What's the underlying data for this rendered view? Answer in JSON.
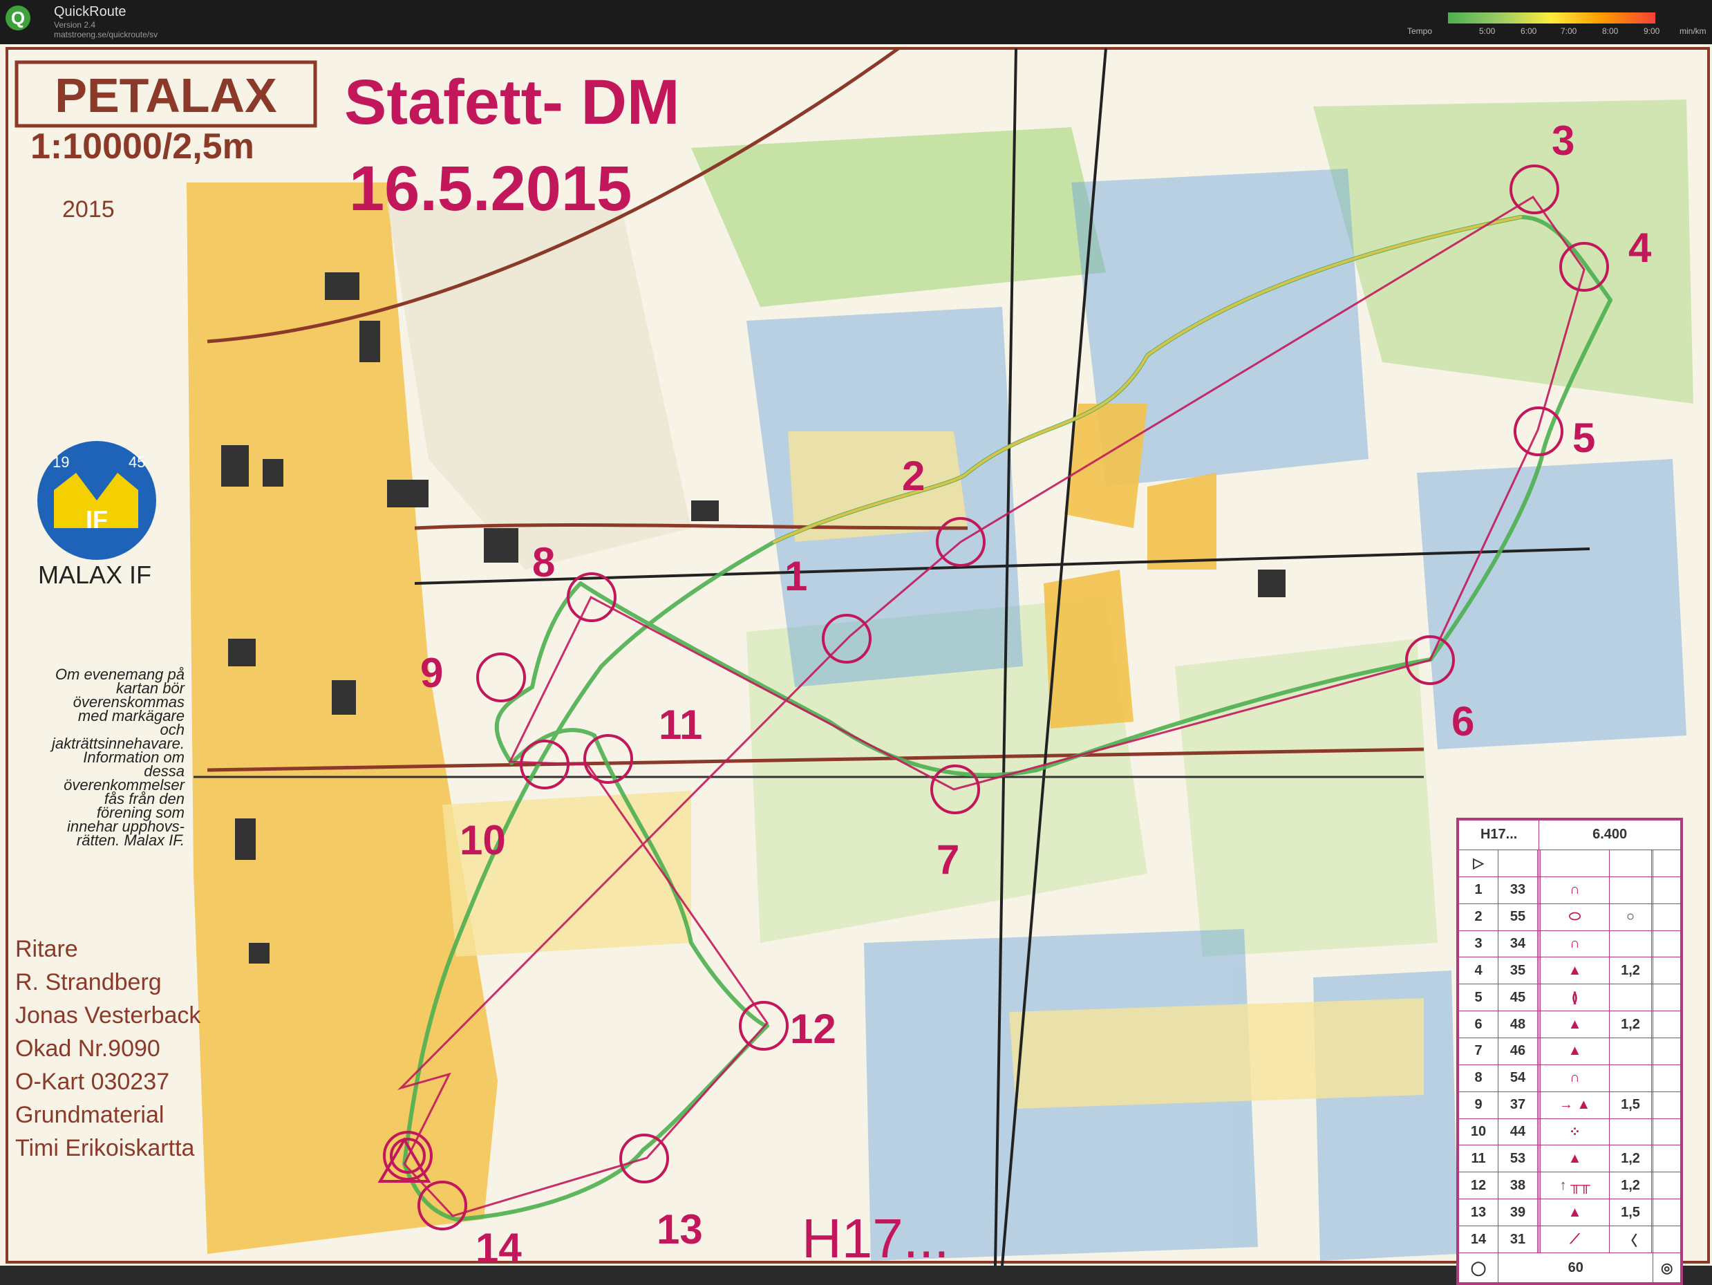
{
  "app": {
    "name": "QuickRoute",
    "version": "Version 2.4",
    "url": "matstroeng.se/quickroute/sv",
    "tempo_label": "Tempo",
    "tempo_ticks": [
      "5:00",
      "6:00",
      "7:00",
      "8:00",
      "9:00",
      "min/km"
    ]
  },
  "map": {
    "club_name": "PETALAX",
    "scale": "1:10000/2,5m",
    "year": "2015",
    "event_title": "Stafett- DM",
    "event_date": "16.5.2015",
    "class_label": "H17...",
    "club_logo_text": {
      "years_left": "19",
      "years_right": "45",
      "letters": "IF"
    },
    "club_caption": "MALAX  IF",
    "notice_lines": [
      "Om evenemang på",
      "kartan bör",
      "överenskommas",
      "med markägare",
      "och",
      "jakträttsinnehavare.",
      "Information om",
      "dessa",
      "överenkommelser",
      "fås från den",
      "förening som",
      "innehar upphovs-",
      "rätten. Malax IF."
    ],
    "credits": [
      "Ritare",
      "R. Strandberg",
      "Jonas Vesterback",
      "Okad Nr.9090",
      "O-Kart 030237",
      "Grundmaterial",
      "Timi Erikoiskartta"
    ],
    "controls": [
      {
        "n": "1"
      },
      {
        "n": "2"
      },
      {
        "n": "3"
      },
      {
        "n": "4"
      },
      {
        "n": "5"
      },
      {
        "n": "6"
      },
      {
        "n": "7"
      },
      {
        "n": "8"
      },
      {
        "n": "9"
      },
      {
        "n": "10"
      },
      {
        "n": "11"
      },
      {
        "n": "12"
      },
      {
        "n": "13"
      },
      {
        "n": "14"
      }
    ],
    "colors": {
      "course": "#c2185b",
      "route_green": "#4caf50",
      "route_yellow": "#e8c34a",
      "map_bg": "#ffffff",
      "forest_green": "#b7dc8f",
      "open_yellow": "#f2c24b",
      "marsh_blue": "#5a9bd4",
      "road_brown": "#8b3a2a"
    }
  },
  "description_sheet": {
    "class": "H17...",
    "length": "6.400",
    "rows": [
      {
        "n": "1",
        "code": "33",
        "feature": "∩",
        "extra": ""
      },
      {
        "n": "2",
        "code": "55",
        "feature": "⬭",
        "extra": "○"
      },
      {
        "n": "3",
        "code": "34",
        "feature": "∩",
        "extra": ""
      },
      {
        "n": "4",
        "code": "35",
        "feature": "▲",
        "extra": "1,2"
      },
      {
        "n": "5",
        "code": "45",
        "feature": "≬",
        "extra": ""
      },
      {
        "n": "6",
        "code": "48",
        "feature": "▲",
        "extra": "1,2"
      },
      {
        "n": "7",
        "code": "46",
        "feature": "▲",
        "extra": ""
      },
      {
        "n": "8",
        "code": "54",
        "feature": "∩",
        "extra": ""
      },
      {
        "n": "9",
        "code": "37",
        "feature": "→ ▲",
        "extra": "1,5"
      },
      {
        "n": "10",
        "code": "44",
        "feature": "⁘",
        "extra": ""
      },
      {
        "n": "11",
        "code": "53",
        "feature": "▲",
        "extra": "1,2"
      },
      {
        "n": "12",
        "code": "38",
        "feature": "↑ ╥╥",
        "extra": "1,2"
      },
      {
        "n": "13",
        "code": "39",
        "feature": "▲",
        "extra": "1,5"
      },
      {
        "n": "14",
        "code": "31",
        "feature": "⟋",
        "extra": "〈"
      }
    ],
    "finish_distance": "60"
  }
}
